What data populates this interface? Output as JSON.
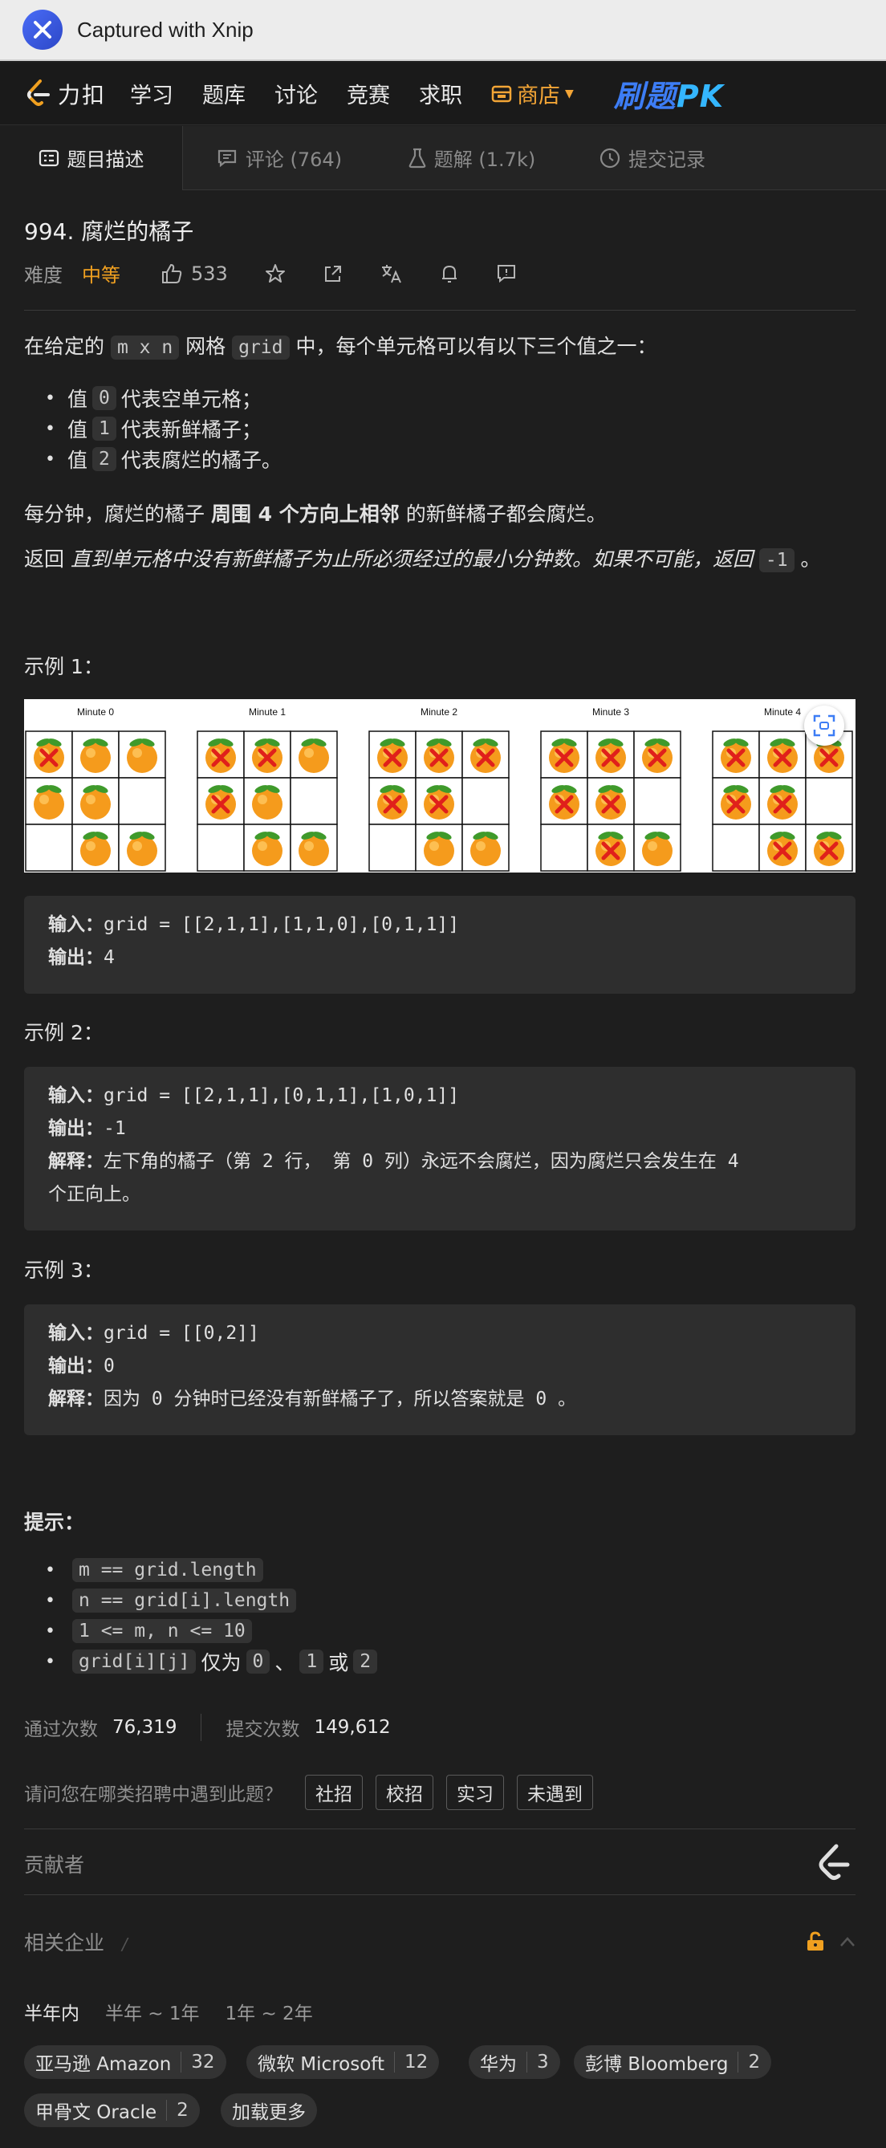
{
  "xnip": {
    "title": "Captured with Xnip"
  },
  "topnav": {
    "brand": "力扣",
    "items": [
      "学习",
      "题库",
      "讨论",
      "竞赛",
      "求职"
    ],
    "store": "商店",
    "pk": "刷题",
    "pk2": "PK"
  },
  "tabs": [
    {
      "label": "题目描述",
      "icon": "description-icon"
    },
    {
      "label": "评论 (764)",
      "icon": "comment-icon"
    },
    {
      "label": "题解 (1.7k)",
      "icon": "flask-icon"
    },
    {
      "label": "提交记录",
      "icon": "clock-icon"
    }
  ],
  "problem": {
    "title": "994. 腐烂的橘子",
    "difficulty_label": "难度",
    "difficulty": "中等",
    "likes": "533"
  },
  "desc": {
    "p1_a": "在给定的 ",
    "p1_code1": "m x n",
    "p1_b": " 网格 ",
    "p1_code2": "grid",
    "p1_c": " 中，每个单元格可以有以下三个值之一：",
    "bullets": [
      {
        "pre": "值 ",
        "code": "0",
        "post": " 代表空单元格；"
      },
      {
        "pre": "值 ",
        "code": "1",
        "post": " 代表新鲜橘子；"
      },
      {
        "pre": "值 ",
        "code": "2",
        "post": " 代表腐烂的橘子。"
      }
    ],
    "p2_a": "每分钟，腐烂的橘子 ",
    "p2_bold": "周围 4 个方向上相邻",
    "p2_b": " 的新鲜橘子都会腐烂。",
    "p3_a": "返回 ",
    "p3_italic": "直到单元格中没有新鲜橘子为止所必须经过的最小分钟数。如果不可能，返回 ",
    "p3_code": "-1",
    "p3_b": " 。"
  },
  "figure": {
    "panels": [
      {
        "title": "Minute 0",
        "grid": [
          [
            2,
            1,
            1
          ],
          [
            1,
            1,
            0
          ],
          [
            0,
            1,
            1
          ]
        ]
      },
      {
        "title": "Minute 1",
        "grid": [
          [
            2,
            2,
            1
          ],
          [
            2,
            1,
            0
          ],
          [
            0,
            1,
            1
          ]
        ]
      },
      {
        "title": "Minute 2",
        "grid": [
          [
            2,
            2,
            2
          ],
          [
            2,
            2,
            0
          ],
          [
            0,
            1,
            1
          ]
        ]
      },
      {
        "title": "Minute 3",
        "grid": [
          [
            2,
            2,
            2
          ],
          [
            2,
            2,
            0
          ],
          [
            0,
            2,
            1
          ]
        ]
      },
      {
        "title": "Minute 4",
        "grid": [
          [
            2,
            2,
            2
          ],
          [
            2,
            2,
            0
          ],
          [
            0,
            2,
            2
          ]
        ]
      }
    ]
  },
  "examples": [
    {
      "heading": "示例 1：",
      "input_label": "输入：",
      "input": "grid = [[2,1,1],[1,1,0],[0,1,1]]",
      "output_label": "输出：",
      "output": "4"
    },
    {
      "heading": "示例 2：",
      "input_label": "输入：",
      "input": "grid = [[2,1,1],[0,1,1],[1,0,1]]",
      "output_label": "输出：",
      "output": "-1",
      "explain_label": "解释：",
      "explain1": "左下角的橘子（第 2 行， 第 0 列）永远不会腐烂，因为腐烂只会发生在 4",
      "explain2": "个正向上。"
    },
    {
      "heading": "示例 3：",
      "input_label": "输入：",
      "input": "grid = [[0,2]]",
      "output_label": "输出：",
      "output": "0",
      "explain_label": "解释：",
      "explain1": "因为 0 分钟时已经没有新鲜橘子了，所以答案就是 0 。"
    }
  ],
  "hints": {
    "heading": "提示：",
    "items": [
      {
        "code": "m == grid.length"
      },
      {
        "code": "n == grid[i].length"
      },
      {
        "code": "1 <= m, n <= 10"
      },
      {
        "code": "grid[i][j]",
        "t1": " 仅为 ",
        "c1": "0",
        "t2": "、",
        "c2": "1",
        "t3": " 或 ",
        "c3": "2"
      }
    ]
  },
  "stats": {
    "accepted_label": "通过次数",
    "accepted": "76,319",
    "submitted_label": "提交次数",
    "submitted": "149,612"
  },
  "recruit": {
    "question": "请问您在哪类招聘中遇到此题？",
    "options": [
      "社招",
      "校招",
      "实习",
      "未遇到"
    ]
  },
  "contributors": {
    "label": "贡献者"
  },
  "related": {
    "label": "相关企业",
    "slash": "/"
  },
  "time_tabs": [
    "半年内",
    "半年 ~ 1年",
    "1年 ~ 2年"
  ],
  "companies": [
    {
      "name": "亚马逊 Amazon",
      "count": "32"
    },
    {
      "name": "微软 Microsoft",
      "count": "12"
    },
    {
      "name": "华为",
      "count": "3"
    },
    {
      "name": "彭博 Bloomberg",
      "count": "2"
    },
    {
      "name": "甲骨文 Oracle",
      "count": "2"
    }
  ],
  "load_more": "加载更多",
  "colors": {
    "accent": "#f0a020",
    "background": "#1e1e1e",
    "code_bg": "#2e2e2e",
    "pk_blue": "#3d7df5"
  }
}
